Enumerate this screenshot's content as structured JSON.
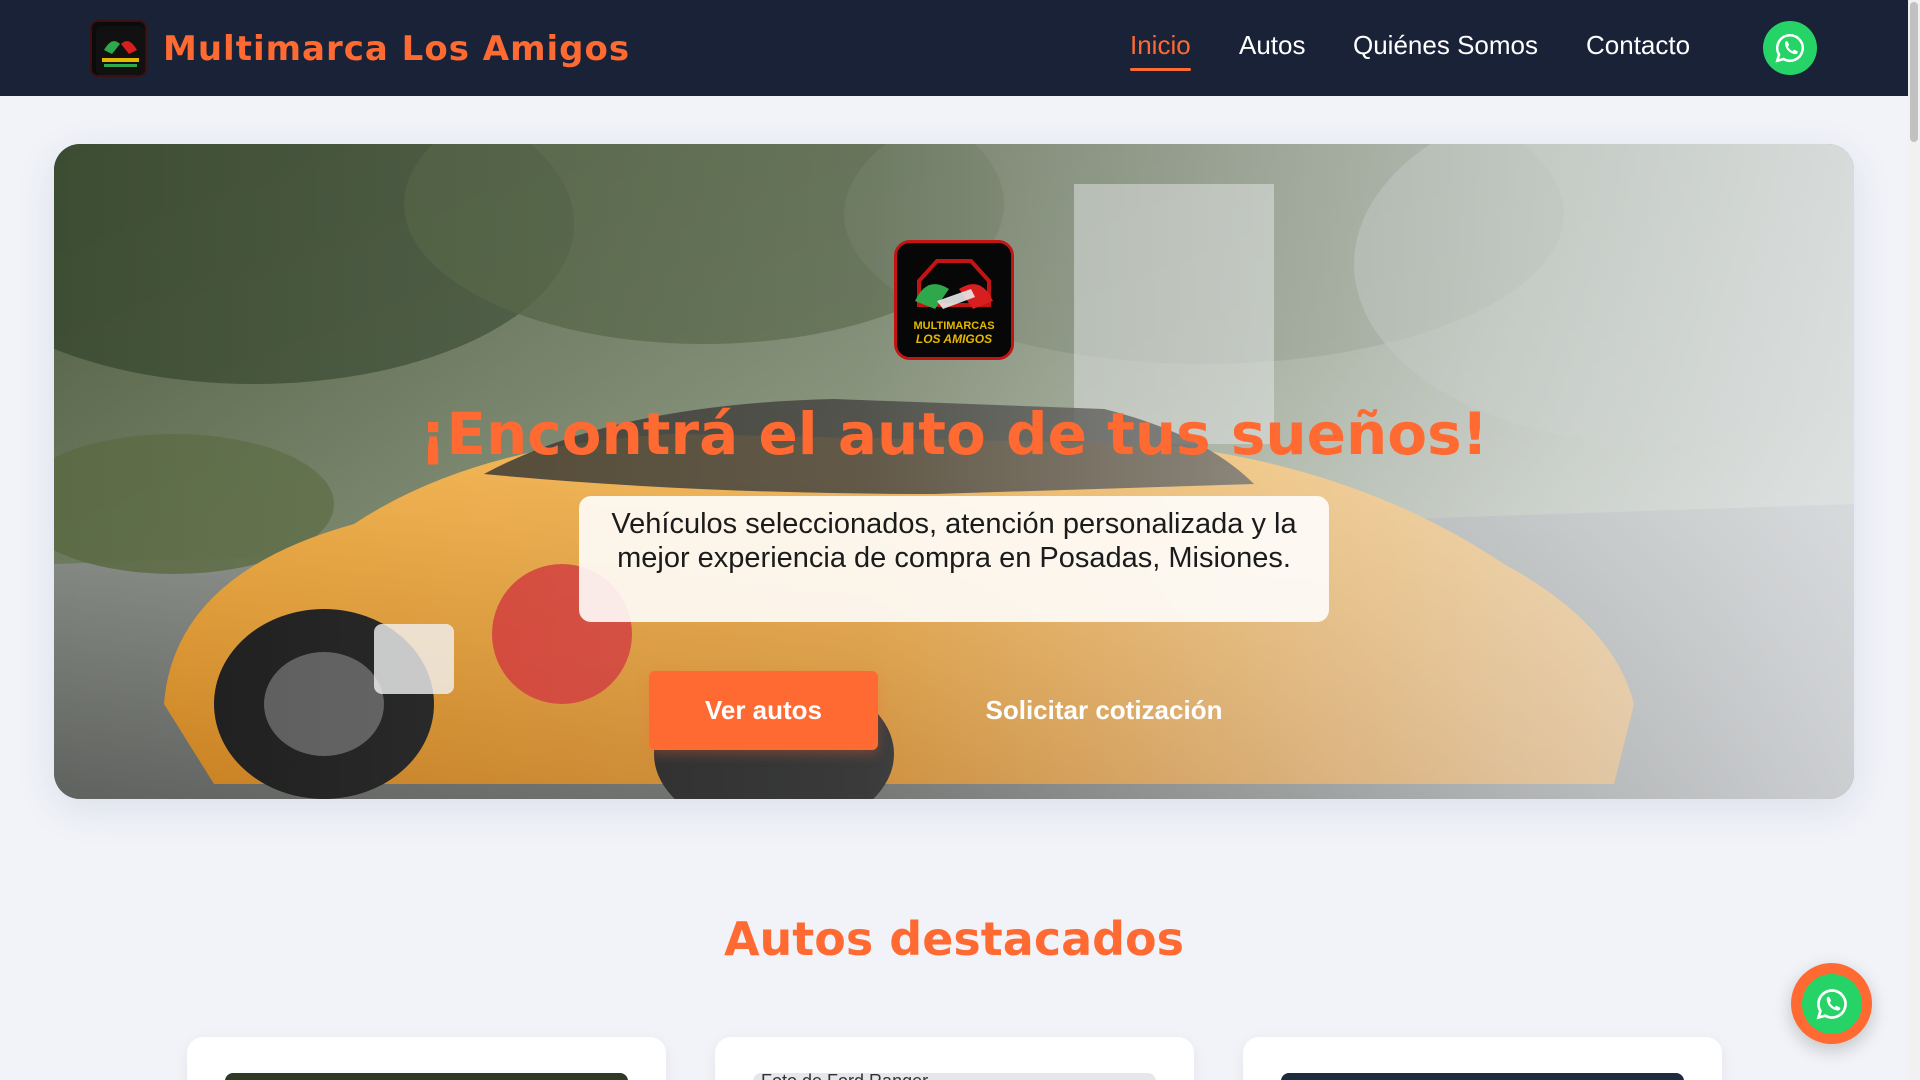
{
  "header": {
    "brand_name": "Multimarca Los Amigos",
    "nav": [
      {
        "label": "Inicio",
        "active": true
      },
      {
        "label": "Autos",
        "active": false
      },
      {
        "label": "Quiénes Somos",
        "active": false
      },
      {
        "label": "Contacto",
        "active": false
      }
    ],
    "whatsapp_icon": "whatsapp-icon"
  },
  "logo": {
    "line1": "MULTIMARCAS",
    "line2": "LOS AMIGOS"
  },
  "hero": {
    "title": "¡Encontrá el auto de tus sueños!",
    "subtitle": "Vehículos seleccionados, atención personalizada y la mejor experiencia de compra en Posadas, Misiones.",
    "primary_button": "Ver autos",
    "secondary_button": "Solicitar cotización",
    "background": "orange sports car on tree-lined street"
  },
  "featured": {
    "title": "Autos destacados",
    "cards": [
      {
        "label": ""
      },
      {
        "label": "Foto de Ford Ranger ..."
      },
      {
        "label": ""
      }
    ]
  },
  "colors": {
    "accent": "#ff6a32",
    "header_bg": "#1a2238",
    "whatsapp": "#25d366",
    "page_bg": "#f1f3f8"
  }
}
